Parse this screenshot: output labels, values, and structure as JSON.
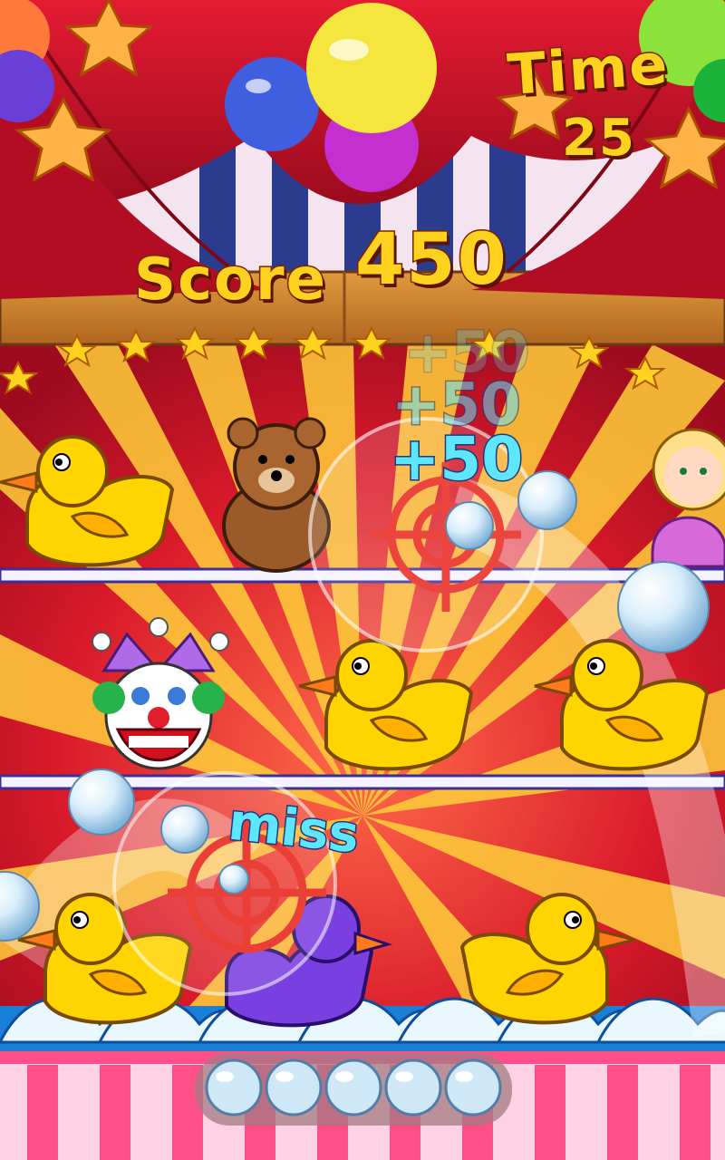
{
  "hud": {
    "time_label": "Time",
    "time_value": "25",
    "score_label": "Score",
    "score_value": "450"
  },
  "popups": {
    "hit_bonus": "+50",
    "miss": "miss"
  },
  "ammo": {
    "remaining": 5
  },
  "targets": {
    "shelf_top": [
      "rubber-duck",
      "teddy-bear",
      "doll"
    ],
    "shelf_middle": [
      "jester-clown",
      "rubber-duck",
      "rubber-duck"
    ],
    "shelf_bottom": [
      "rubber-duck",
      "purple-duck",
      "rubber-duck"
    ]
  },
  "colors": {
    "curtain": "#c8102e",
    "gold": "#ffd21f",
    "bubble": "#cfe8f7",
    "duck": "#ffd400",
    "wave": "#1e88d8"
  }
}
